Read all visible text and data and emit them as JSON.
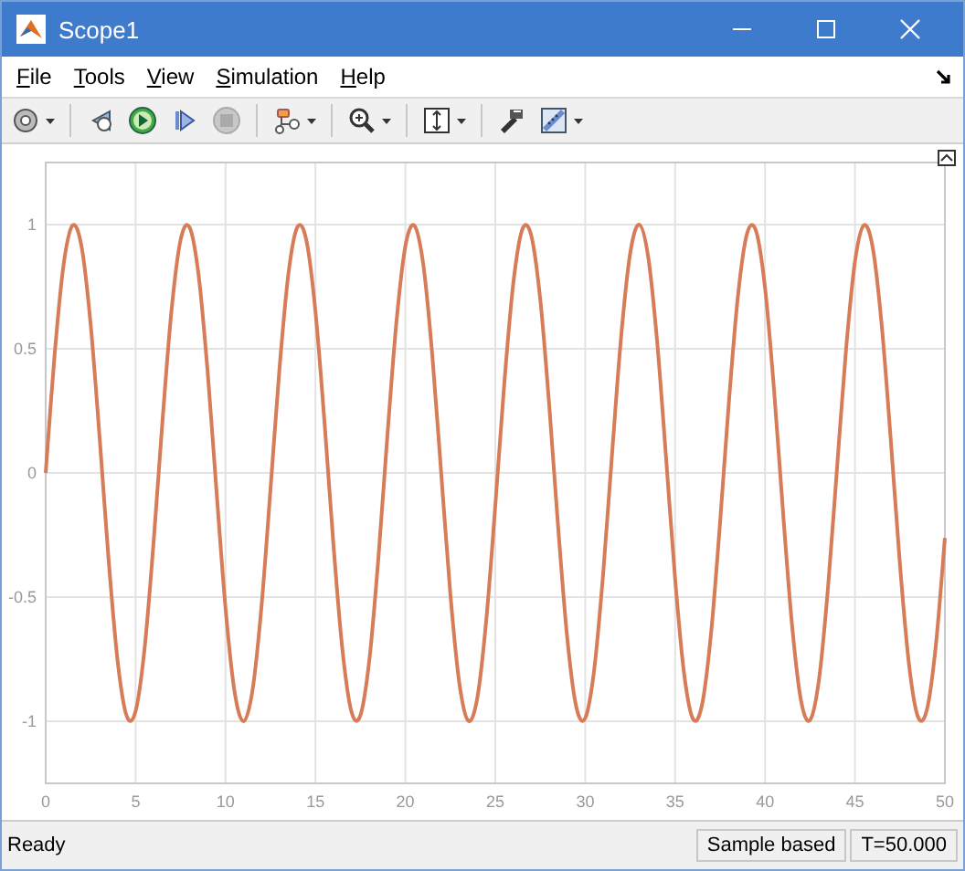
{
  "window": {
    "title": "Scope1"
  },
  "menu": [
    "File",
    "Tools",
    "View",
    "Simulation",
    "Help"
  ],
  "toolbar": [
    {
      "kind": "settings",
      "dropdown": true
    },
    {
      "kind": "separator"
    },
    {
      "kind": "step-back",
      "dropdown": false
    },
    {
      "kind": "run",
      "dropdown": false
    },
    {
      "kind": "step-forward",
      "dropdown": false
    },
    {
      "kind": "stop",
      "dropdown": false
    },
    {
      "kind": "separator"
    },
    {
      "kind": "highlight",
      "dropdown": true
    },
    {
      "kind": "separator"
    },
    {
      "kind": "zoom",
      "dropdown": true
    },
    {
      "kind": "separator"
    },
    {
      "kind": "scale",
      "dropdown": true
    },
    {
      "kind": "separator"
    },
    {
      "kind": "style",
      "dropdown": false
    },
    {
      "kind": "measure",
      "dropdown": true
    }
  ],
  "plot": {
    "chart_data": {
      "type": "line",
      "x": [
        0,
        0.5,
        1,
        1.5,
        2,
        2.5,
        3,
        3.5,
        4,
        4.5,
        5,
        5.5,
        6,
        6.5,
        7,
        7.5,
        8,
        8.5,
        9,
        9.5,
        10,
        10.5,
        11,
        11.5,
        12,
        12.5,
        13,
        13.5,
        14,
        14.5,
        15,
        15.5,
        16,
        16.5,
        17,
        17.5,
        18,
        18.5,
        19,
        19.5,
        20,
        20.5,
        21,
        21.5,
        22,
        22.5,
        23,
        23.5,
        24,
        24.5,
        25,
        25.5,
        26,
        26.5,
        27,
        27.5,
        28,
        28.5,
        29,
        29.5,
        30,
        30.5,
        31,
        31.5,
        32,
        32.5,
        33,
        33.5,
        34,
        34.5,
        35,
        35.5,
        36,
        36.5,
        37,
        37.5,
        38,
        38.5,
        39,
        39.5,
        40,
        40.5,
        41,
        41.5,
        42,
        42.5,
        43,
        43.5,
        44,
        44.5,
        45,
        45.5,
        46,
        46.5,
        47,
        47.5,
        48,
        48.5,
        49,
        49.5,
        50
      ],
      "series": [
        {
          "color": "#d67d57",
          "values": [
            0,
            0.479,
            0.841,
            0.997,
            0.909,
            0.598,
            0.141,
            -0.351,
            -0.757,
            -0.978,
            -0.959,
            -0.706,
            -0.279,
            0.215,
            0.657,
            0.938,
            0.989,
            0.798,
            0.412,
            -0.075,
            -0.544,
            -0.88,
            -1,
            -0.875,
            -0.537,
            -0.066,
            0.42,
            0.804,
            0.991,
            0.935,
            0.65,
            0.207,
            -0.288,
            -0.712,
            -0.961,
            -0.976,
            -0.751,
            -0.342,
            0.15,
            0.605,
            0.913,
            0.996,
            0.837,
            0.471,
            -0.009,
            -0.487,
            -0.846,
            -0.998,
            -0.906,
            -0.591,
            -0.132,
            0.36,
            0.763,
            0.98,
            0.956,
            0.699,
            0.271,
            -0.224,
            -0.664,
            -0.941,
            -0.988,
            -0.792,
            -0.404,
            0.084,
            0.551,
            0.884,
            1,
            0.871,
            0.529,
            0.057,
            -0.428,
            -0.809,
            -0.992,
            -0.932,
            -0.644,
            -0.198,
            0.296,
            0.718,
            0.964,
            0.974,
            0.745,
            0.334,
            -0.158,
            -0.612,
            -0.917,
            -0.995,
            -0.832,
            -0.463,
            0.018,
            0.494,
            0.851,
            0.998,
            0.902,
            0.584,
            0.124,
            -0.368,
            -0.768,
            -0.982,
            -0.953,
            -0.692,
            -0.262
          ]
        }
      ],
      "xlim": [
        0,
        50
      ],
      "ylim": [
        -1.25,
        1.25
      ],
      "xticks": [
        0,
        5,
        10,
        15,
        20,
        25,
        30,
        35,
        40,
        45,
        50
      ],
      "yticks": [
        -1,
        -0.5,
        0,
        0.5,
        1
      ],
      "grid": true
    }
  },
  "status_bar": {
    "message": "Ready",
    "fields": [
      "Sample based",
      "T=50.000"
    ]
  }
}
